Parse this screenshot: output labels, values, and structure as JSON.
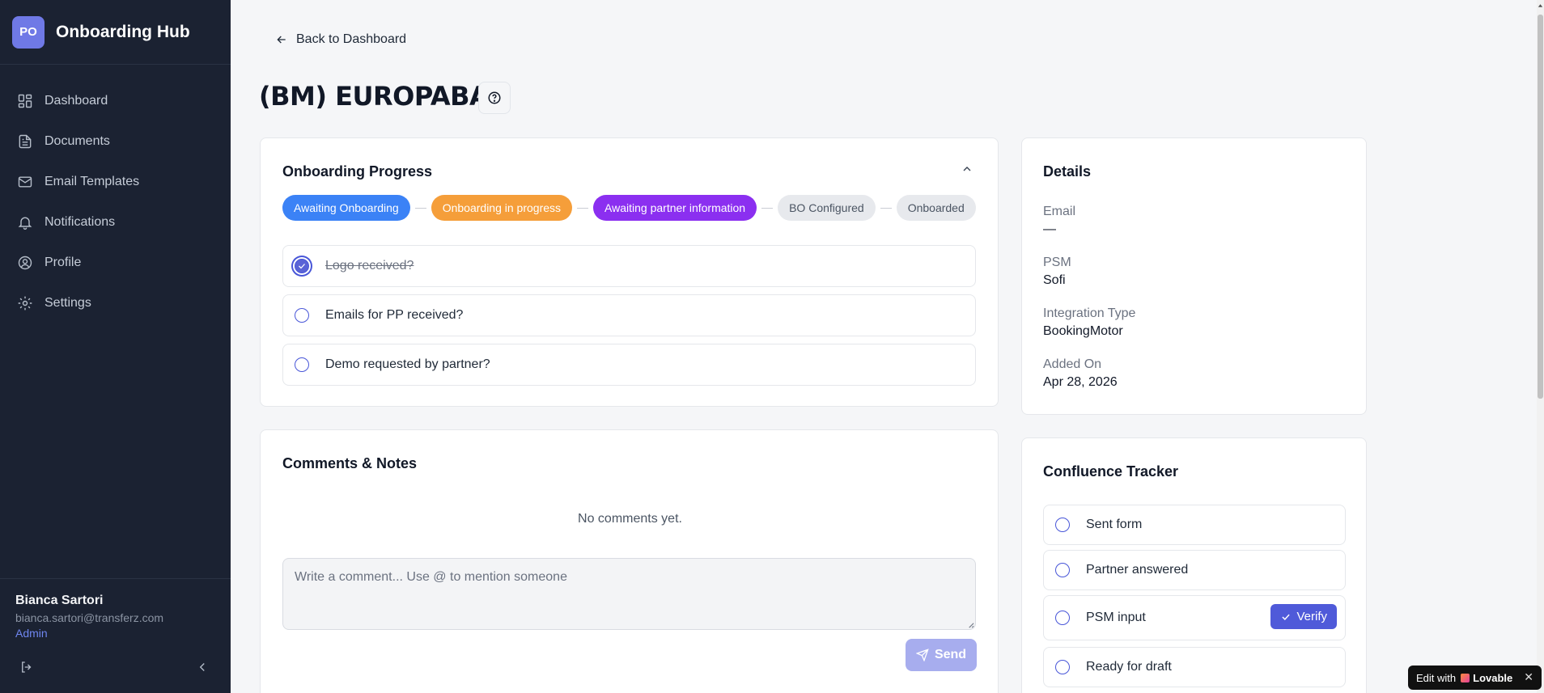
{
  "brand": {
    "initials": "PO",
    "title": "Onboarding Hub"
  },
  "nav": [
    {
      "label": "Dashboard",
      "icon": "dashboard-icon"
    },
    {
      "label": "Documents",
      "icon": "document-icon"
    },
    {
      "label": "Email Templates",
      "icon": "mail-icon"
    },
    {
      "label": "Notifications",
      "icon": "bell-icon"
    },
    {
      "label": "Profile",
      "icon": "user-icon"
    },
    {
      "label": "Settings",
      "icon": "gear-icon"
    }
  ],
  "user": {
    "name": "Bianca Sartori",
    "email": "bianca.sartori@transferz.com",
    "role": "Admin"
  },
  "back_label": "Back to Dashboard",
  "page_title": "(BM) EUROPABA",
  "progress": {
    "title": "Onboarding Progress",
    "stages": [
      {
        "label": "Awaiting Onboarding",
        "color": "#3b82f6"
      },
      {
        "label": "Onboarding in progress",
        "color": "#f59e3a"
      },
      {
        "label": "Awaiting partner information",
        "color": "#8b2ff0"
      },
      {
        "label": "BO Configured",
        "color": "#e7e9ed"
      },
      {
        "label": "Onboarded",
        "color": "#e7e9ed"
      }
    ],
    "checklist": [
      {
        "label": "Logo received?",
        "checked": true
      },
      {
        "label": "Emails for PP received?",
        "checked": false
      },
      {
        "label": "Demo requested by partner?",
        "checked": false
      }
    ]
  },
  "details": {
    "title": "Details",
    "email_label": "Email",
    "email_value": "—",
    "psm_label": "PSM",
    "psm_value": "Sofi",
    "integration_label": "Integration Type",
    "integration_value": "BookingMotor",
    "added_label": "Added On",
    "added_value": "Apr 28, 2026"
  },
  "comments": {
    "title": "Comments & Notes",
    "empty_text": "No comments yet.",
    "placeholder": "Write a comment... Use @ to mention someone",
    "send_label": "Send"
  },
  "tracker": {
    "title": "Confluence Tracker",
    "items": [
      {
        "label": "Sent form"
      },
      {
        "label": "Partner answered"
      },
      {
        "label": "PSM input",
        "action": "Verify"
      },
      {
        "label": "Ready for draft"
      }
    ]
  },
  "badge": {
    "prefix": "Edit with",
    "brand": "Lovable",
    "close": "✕"
  },
  "colors": {
    "sidebar_bg": "#1b2232",
    "accent": "#4f5ad9",
    "page_bg": "#f5f6f8"
  }
}
